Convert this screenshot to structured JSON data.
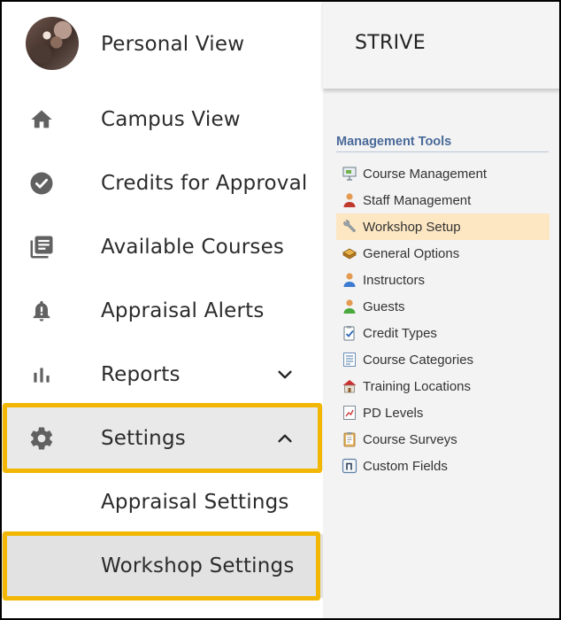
{
  "sidebar": {
    "profile": {
      "name": "Personal View",
      "avatar_icon": "user-avatar"
    },
    "items": [
      {
        "label": "Campus View",
        "icon": "home-icon"
      },
      {
        "label": "Credits for Approval",
        "icon": "check-circle-icon"
      },
      {
        "label": "Available Courses",
        "icon": "library-books-icon"
      },
      {
        "label": "Appraisal Alerts",
        "icon": "alert-bell-icon"
      },
      {
        "label": "Reports",
        "icon": "bar-chart-icon",
        "expanded": false
      },
      {
        "label": "Settings",
        "icon": "gear-icon",
        "expanded": true
      }
    ],
    "settings_sub": [
      {
        "label": "Appraisal Settings"
      },
      {
        "label": "Workshop Settings"
      }
    ]
  },
  "header": {
    "title": "STRIVE"
  },
  "management": {
    "title": "Management Tools",
    "tools": [
      {
        "label": "Course Management",
        "icon": "presentation-icon"
      },
      {
        "label": "Staff Management",
        "icon": "staff-person-icon"
      },
      {
        "label": "Workshop Setup",
        "icon": "wrench-icon",
        "active": true
      },
      {
        "label": "General Options",
        "icon": "options-box-icon"
      },
      {
        "label": "Instructors",
        "icon": "instructor-person-icon"
      },
      {
        "label": "Guests",
        "icon": "guest-person-icon"
      },
      {
        "label": "Credit Types",
        "icon": "clipboard-check-icon"
      },
      {
        "label": "Course Categories",
        "icon": "list-document-icon"
      },
      {
        "label": "Training Locations",
        "icon": "building-icon"
      },
      {
        "label": "PD Levels",
        "icon": "chart-document-icon"
      },
      {
        "label": "Course Surveys",
        "icon": "survey-clipboard-icon"
      },
      {
        "label": "Custom Fields",
        "icon": "custom-field-icon"
      }
    ]
  },
  "colors": {
    "highlight": "#f2b705",
    "active_tool_bg": "#fde7c3",
    "section_title": "#4a6a9a",
    "sidebar_icon": "#616161"
  }
}
